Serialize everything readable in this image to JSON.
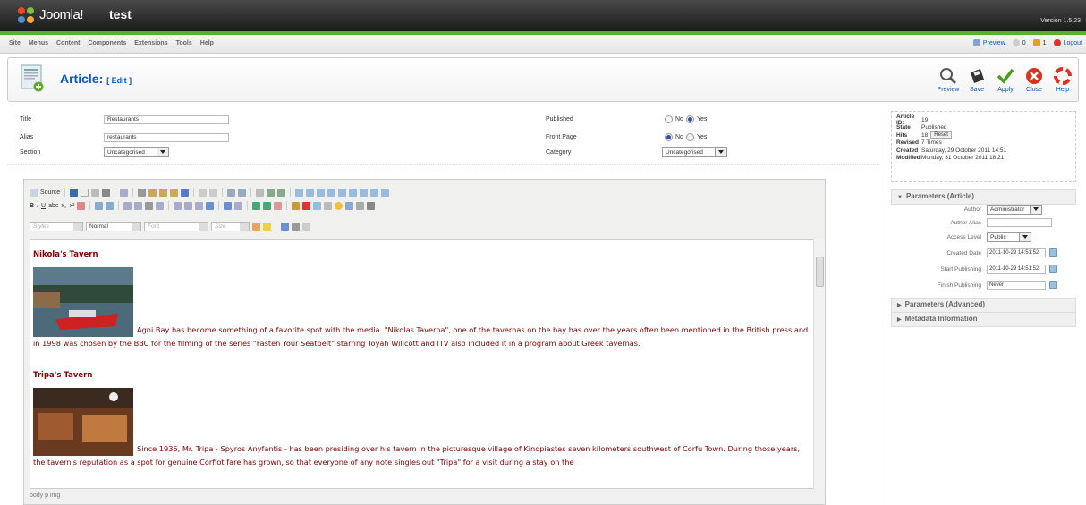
{
  "header": {
    "brand": "Joomla!",
    "site_name": "test",
    "version": "Version 1.5.23"
  },
  "menu": [
    "Site",
    "Menus",
    "Content",
    "Components",
    "Extensions",
    "Tools",
    "Help"
  ],
  "status": {
    "preview": "Preview",
    "messages": "0",
    "users": "1",
    "logout": "Logout"
  },
  "toolbar": {
    "title": "Article:",
    "title_suffix": "[ Edit ]",
    "buttons": {
      "preview": "Preview",
      "save": "Save",
      "apply": "Apply",
      "close": "Close",
      "help": "Help"
    }
  },
  "form": {
    "title_label": "Title",
    "title_value": "Restaurants",
    "alias_label": "Alias",
    "alias_value": "restaurants",
    "section_label": "Section",
    "section_value": "Uncategorised",
    "published_label": "Published",
    "frontpage_label": "Front Page",
    "category_label": "Category",
    "category_value": "Uncategorised",
    "no": "No",
    "yes": "Yes"
  },
  "editor": {
    "source_label": "Source",
    "styles": "Styles",
    "format": "Normal",
    "font": "Font",
    "size": "Size",
    "h1": "Nikola's Tavern",
    "p1": "Agni Bay has become something of a favorite spot with the media. \"Nikolas Taverna\", one of the tavernas on the bay has over the years often been mentioned in the British press and in 1998 was chosen by the BBC for the filming of the series \"Fasten Your Seatbelt\" starring Toyah Willcott and ITV also included it in a program about Greek tavernas.",
    "h2": "Tripa's Tavern",
    "p2": "Since 1936, Mr. Tripa - Spyros Anyfantis - has been presiding over his tavern in the picturesque village of Kinopiastes seven kilometers southwest of Corfu Town. During those years, the tavern's reputation as a spot for genuine Corfiot fare has grown, so that everyone of any note singles out \"Tripa\" for a visit during a stay on the",
    "path": "body  p  img"
  },
  "info": {
    "article_id_label": "Article ID:",
    "article_id": "19",
    "state_label": "State",
    "state": "Published",
    "hits_label": "Hits",
    "hits": "18",
    "reset": "Reset",
    "revised_label": "Revised",
    "revised": "7 Times",
    "created_label": "Created",
    "created": "Saturday, 29 October 2011 14:51",
    "modified_label": "Modified",
    "modified": "Monday, 31 October 2011 18:21"
  },
  "params": {
    "title": "Parameters (Article)",
    "author_label": "Author",
    "author": "Administrator",
    "alias_label": "Author Alias",
    "access_label": "Access Level",
    "access": "Public",
    "created_label": "Created Date",
    "created": "2011-10-29 14:51:52",
    "start_label": "Start Publishing",
    "start": "2011-10-29 14:51:52",
    "finish_label": "Finish Publishing",
    "finish": "Never",
    "advanced": "Parameters (Advanced)",
    "metadata": "Metadata Information"
  }
}
